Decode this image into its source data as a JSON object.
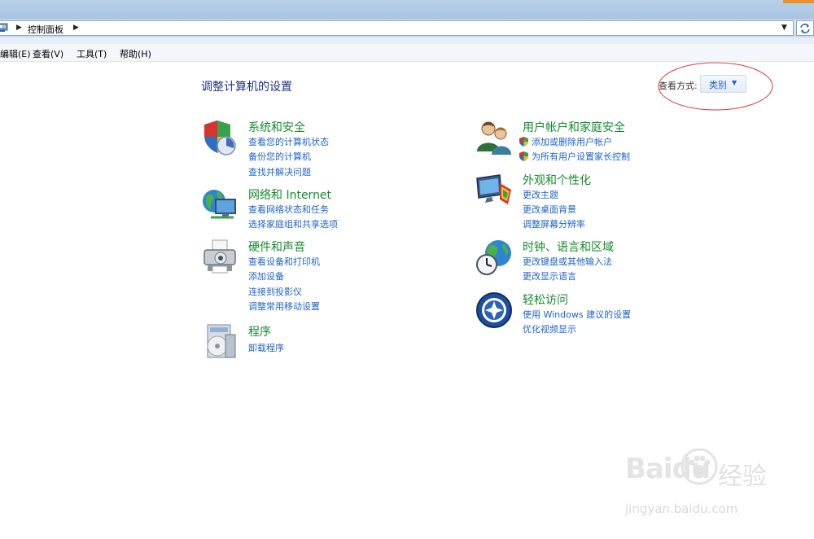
{
  "window": {
    "accent_color": "#e7932d"
  },
  "address": {
    "path": [
      "控制面板"
    ],
    "icon": "control-panel-icon",
    "refresh_icon": "refresh-icon"
  },
  "menu": [
    "编辑(E)",
    "查看(V)",
    "工具(T)",
    "帮助(H)"
  ],
  "main": {
    "title": "调整计算机的设置",
    "view_by": {
      "label": "查看方式:",
      "value": "类别"
    }
  },
  "categories": [
    {
      "title": "系统和安全",
      "icon": "security-shield-icon",
      "links": [
        "查看您的计算机状态",
        "备份您的计算机",
        "查找并解决问题"
      ]
    },
    {
      "title": "网络和 Internet",
      "icon": "network-globe-icon",
      "links": [
        "查看网络状态和任务",
        "选择家庭组和共享选项"
      ]
    },
    {
      "title": "硬件和声音",
      "icon": "printer-icon",
      "links": [
        "查看设备和打印机",
        "添加设备",
        "连接到投影仪",
        "调整常用移动设置"
      ]
    },
    {
      "title": "程序",
      "icon": "programs-disc-icon",
      "links": [
        "卸载程序"
      ]
    },
    {
      "title": "用户帐户和家庭安全",
      "icon": "users-icon",
      "links": [
        "添加或删除用户帐户",
        "为所有用户设置家长控制"
      ]
    },
    {
      "title": "外观和个性化",
      "icon": "appearance-monitor-icon",
      "links": [
        "更改主题",
        "更改桌面背景",
        "调整屏幕分辨率"
      ]
    },
    {
      "title": "时钟、语言和区域",
      "icon": "clock-globe-icon",
      "links": [
        "更改键盘或其他输入法",
        "更改显示语言"
      ]
    },
    {
      "title": "轻松访问",
      "icon": "ease-of-access-icon",
      "links": [
        "使用 Windows 建议的设置",
        "优化视频显示"
      ]
    }
  ],
  "watermark": {
    "logo": "Baidu",
    "text": "经验",
    "url": "jingyan.baidu.com"
  },
  "colors": {
    "link": "#1e63c8",
    "category_title": "#148a2c",
    "page_title": "#1e3287",
    "annotation": "#e0383e"
  }
}
